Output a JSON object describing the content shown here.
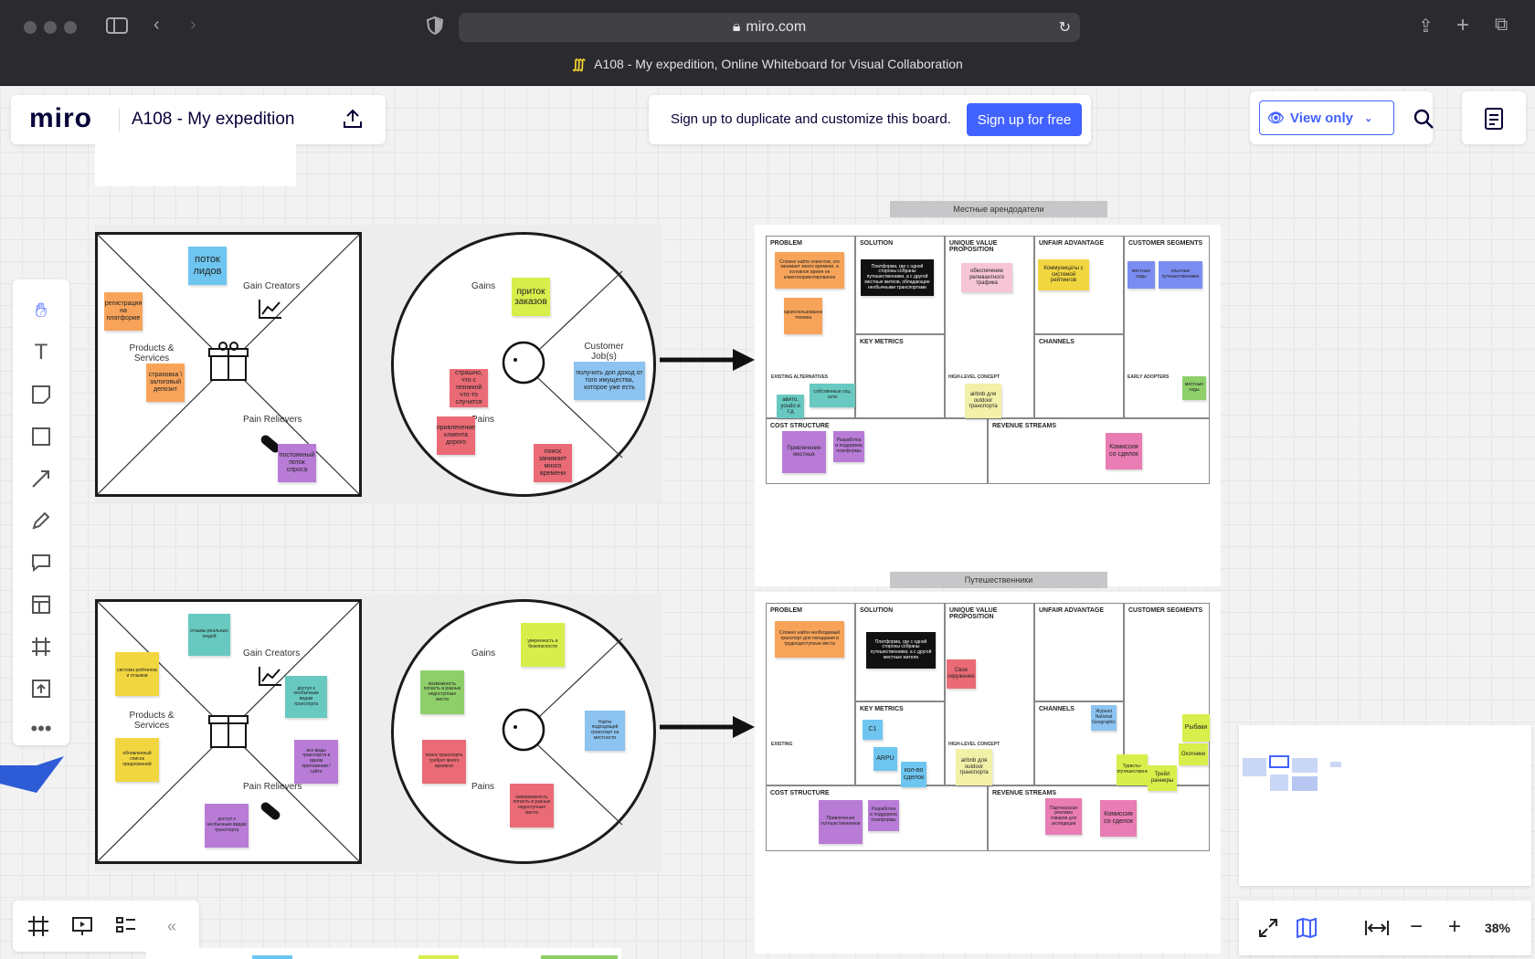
{
  "browser": {
    "url": "miro.com",
    "tab_title": "A108 - My expedition, Online Whiteboard for Visual Collaboration"
  },
  "header": {
    "logo": "miro",
    "board_title": "A108 - My expedition",
    "signup_prompt": "Sign up to duplicate and customize this board.",
    "signup_button": "Sign up for free",
    "view_mode": "View only"
  },
  "colors": {
    "accent": "#4262ff",
    "orange": "#f7a45a",
    "blue": "#6ec6f0",
    "yellow": "#d8ee4a",
    "purple": "#b87cd6",
    "red": "#ea6b76",
    "teal": "#67c9c0",
    "violet": "#7b8df0"
  },
  "zoom": "38%",
  "vpc1": {
    "gain_creators": "Gain Creators",
    "products": "Products & Services",
    "pain_relievers": "Pain Relievers",
    "gains": "Gains",
    "pains": "Pains",
    "jobs": "Customer Job(s)",
    "notes": {
      "n1": "поток лидов",
      "n2": "регистрация на платформе",
      "n3": "страховка \\ залоговый депозит",
      "n4": "постоянный поток спроса",
      "n5": "приток заказов",
      "n6": "получить доп доход от того имущества, которое уже есть",
      "n7": "страшно, что с техникой что-то случится",
      "n8": "привлечение клиента дорого",
      "n9": "поиск занимает много времени"
    }
  },
  "vpc2": {
    "gain_creators": "Gain Creators",
    "products": "Products & Services",
    "pain_relievers": "Pain Relievers",
    "gains": "Gains",
    "pains": "Pains",
    "notes": {
      "n1": "отзывы реальных людей",
      "n2": "система рейтингов и отзывов",
      "n3": "доступ к необычным видам транспорта",
      "n4": "обновленный список предложений",
      "n5": "все виды транспорта в одном приложении / сайте",
      "n6": "доступ к необычным видам транспорта",
      "n7": "уверенность в безопасности",
      "n8": "возможность попасть в разные недоступные места",
      "n9": "Найти подходящий транспорт на местности",
      "n10": "поиск транспорта требует много времени",
      "n11": "невозможность попасть в разные недоступные места"
    }
  },
  "canvas1": {
    "group_label": "Местные арендодатели",
    "problem": "PROBLEM",
    "solution": "SOLUTION",
    "uvp": "UNIQUE VALUE PROPOSITION",
    "unfair": "UNFAIR ADVANTAGE",
    "segments": "CUSTOMER SEGMENTS",
    "metrics": "KEY METRICS",
    "channels": "CHANNELS",
    "cost": "COST STRUCTURE",
    "revenue": "REVENUE STREAMS",
    "existing": "EXISTING ALTERNATIVES",
    "hlc": "HIGH-LEVEL CONCEPT",
    "early": "EARLY ADOPTERS",
    "notes": {
      "a": "Сложно найти клиентов, это занимает много времени, а основное время не клиентоориентированно",
      "b": "Платформа, где с одной стороны собраны путешественники, а с другой местные жители, обладающие необычными транспортами",
      "c": "обеспечение релевантного трафика",
      "d": "Коммуницаты с системой рейтингов",
      "e": "местные гиды",
      "f": "опытные путешественники",
      "g": "недоиспользованная техника",
      "h": "авито, youdo и т.д",
      "i": "собственные соц. сети",
      "j": "airbnb для outdoor транспорта",
      "k": "Привлечение местных",
      "l": "Разработка и поддержка платформы",
      "m": "Комиссия со сделок",
      "n": "местные гиды"
    }
  },
  "canvas2": {
    "group_label": "Путешественники",
    "problem": "PROBLEM",
    "solution": "SOLUTION",
    "uvp": "UNIQUE VALUE PROPOSITION",
    "unfair": "UNFAIR ADVANTAGE",
    "segments": "CUSTOMER SEGMENTS",
    "metrics": "KEY METRICS",
    "channels": "CHANNELS",
    "cost": "COST STRUCTURE",
    "revenue": "REVENUE STREAMS",
    "existing": "EXISTING",
    "hlc": "HIGH-LEVEL CONCEPT",
    "notes": {
      "a": "Сложно найти необходимый транспорт для попадания в труднодоступные места",
      "b": "Платформа, где с одной стороны собраны путешественники, а с другой местные жители",
      "c": "Свое окружение",
      "d": "C1",
      "e": "ARPU",
      "f": "кол-во сделок",
      "g": "airbnb для outdoor транспорта",
      "h": "Журнал National Geographic",
      "i": "Рыбаки",
      "j": "Охотники",
      "k": "Туристы-автопутешественники",
      "l": "Трейл раннеры",
      "m": "Привлечение путешественников",
      "n": "Разработка и поддержка платформы",
      "o": "Партнерская реклама товаров для экспедиции",
      "p": "Комиссия со сделок"
    }
  }
}
